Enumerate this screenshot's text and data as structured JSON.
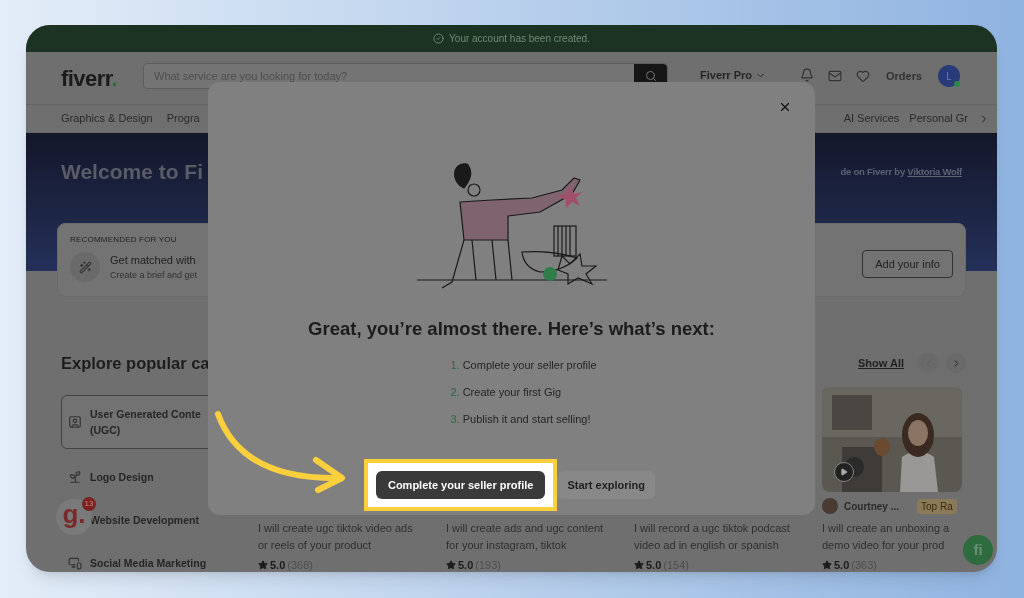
{
  "banner": {
    "text": "Your account has been created."
  },
  "header": {
    "logo": "fiverr",
    "logo_dot": ".",
    "search": {
      "placeholder": "What service are you looking for today?"
    },
    "pro_menu": "Fiverr Pro",
    "orders": "Orders",
    "avatar": "L"
  },
  "nav": {
    "left": [
      "Graphics & Design",
      "Progra"
    ],
    "right": [
      "AI Services",
      "Personal Gr"
    ]
  },
  "hero": {
    "title": "Welcome to Fi",
    "byline": "de on Fiverr by",
    "author": "Viktoria Wolf"
  },
  "recommended": {
    "heading": "RECOMMENDED FOR YOU",
    "title": "Get matched with",
    "subtitle": "Create a brief and get",
    "button": "Add your info"
  },
  "explore": {
    "title": "Explore popular ca",
    "show_all": "Show All",
    "categories": [
      {
        "label": "User Generated Conte (UGC)",
        "selected": true
      },
      {
        "label": "Logo Design",
        "selected": false
      },
      {
        "label": "Website Development",
        "selected": false
      },
      {
        "label": "Social Media Marketing",
        "selected": false
      }
    ]
  },
  "gigs": [
    {
      "kind": "text",
      "description": "I will create ugc tiktok video ads or reels of your product",
      "rating": "5.0",
      "reviews": "(368)"
    },
    {
      "kind": "text",
      "description": "I will create ads and ugc content for your instagram, tiktok",
      "rating": "5.0",
      "reviews": "(193)"
    },
    {
      "kind": "text",
      "description": "I will record a ugc tiktok podcast video ad in english or spanish",
      "rating": "5.0",
      "reviews": "(154)"
    },
    {
      "kind": "picture",
      "seller": "Courtney ...",
      "badge": "Top Ra",
      "description": "I will create an unboxing a demo video for your prod",
      "rating": "5.0",
      "reviews": "(363)"
    }
  ],
  "modal": {
    "title": "Great, you’re almost there. Here’s what’s next:",
    "steps": [
      {
        "number": "1.",
        "text": "Complete your seller profile"
      },
      {
        "number": "2.",
        "text": "Create your first Gig"
      },
      {
        "number": "3.",
        "text": "Publish it and start selling!"
      }
    ],
    "primary": "Complete your seller profile",
    "secondary": "Start exploring"
  },
  "extension_badge": {
    "letter": "g.",
    "count": "13"
  },
  "help_button": {
    "label": "fi"
  }
}
